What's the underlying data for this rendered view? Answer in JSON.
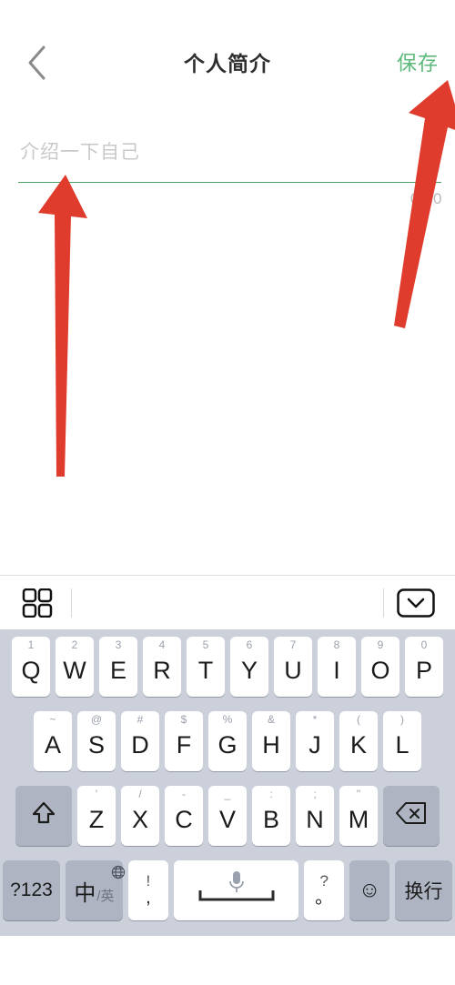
{
  "nav": {
    "back_icon": "chevron-left-icon",
    "title": "个人简介",
    "save_label": "保存",
    "save_color": "#5cb97a"
  },
  "bio": {
    "placeholder": "介绍一下自己",
    "value": "",
    "counter": "0/50",
    "underline_color": "#4e9e68"
  },
  "keyboard": {
    "toolbar": {
      "grid_icon": "grid-2x2-icon",
      "dismiss_icon": "keyboard-dismiss-icon"
    },
    "row1": [
      {
        "hint": "1",
        "main": "Q"
      },
      {
        "hint": "2",
        "main": "W"
      },
      {
        "hint": "3",
        "main": "E"
      },
      {
        "hint": "4",
        "main": "R"
      },
      {
        "hint": "5",
        "main": "T"
      },
      {
        "hint": "6",
        "main": "Y"
      },
      {
        "hint": "7",
        "main": "U"
      },
      {
        "hint": "8",
        "main": "I"
      },
      {
        "hint": "9",
        "main": "O"
      },
      {
        "hint": "0",
        "main": "P"
      }
    ],
    "row2": [
      {
        "hint": "~",
        "main": "A"
      },
      {
        "hint": "@",
        "main": "S"
      },
      {
        "hint": "#",
        "main": "D"
      },
      {
        "hint": "$",
        "main": "F"
      },
      {
        "hint": "%",
        "main": "G"
      },
      {
        "hint": "&",
        "main": "H"
      },
      {
        "hint": "*",
        "main": "J"
      },
      {
        "hint": "(",
        "main": "K"
      },
      {
        "hint": ")",
        "main": "L"
      }
    ],
    "row3": {
      "shift_icon": "shift-arrow-icon",
      "keys": [
        {
          "hint": "'",
          "main": "Z"
        },
        {
          "hint": "/",
          "main": "X"
        },
        {
          "hint": "-",
          "main": "C"
        },
        {
          "hint": "_",
          "main": "V"
        },
        {
          "hint": ":",
          "main": "B"
        },
        {
          "hint": ";",
          "main": "N"
        },
        {
          "hint": "\"",
          "main": "M"
        }
      ],
      "backspace_icon": "backspace-icon"
    },
    "row4": {
      "numbers_label": "?123",
      "lang_cn": "中",
      "lang_en": "/英",
      "globe_icon": "globe-icon",
      "punct_left_top": "!",
      "punct_left_bottom": ",",
      "space_mic_icon": "microphone-icon",
      "space_bar_icon": "space-bar-icon",
      "punct_right_top": "?",
      "punct_right_bottom": "。",
      "emoji_label": "☺",
      "return_label": "换行"
    }
  },
  "annotations": {
    "arrow_color": "#e03c2d",
    "arrow_input_target": "bio-input-field",
    "arrow_save_target": "save-button"
  }
}
